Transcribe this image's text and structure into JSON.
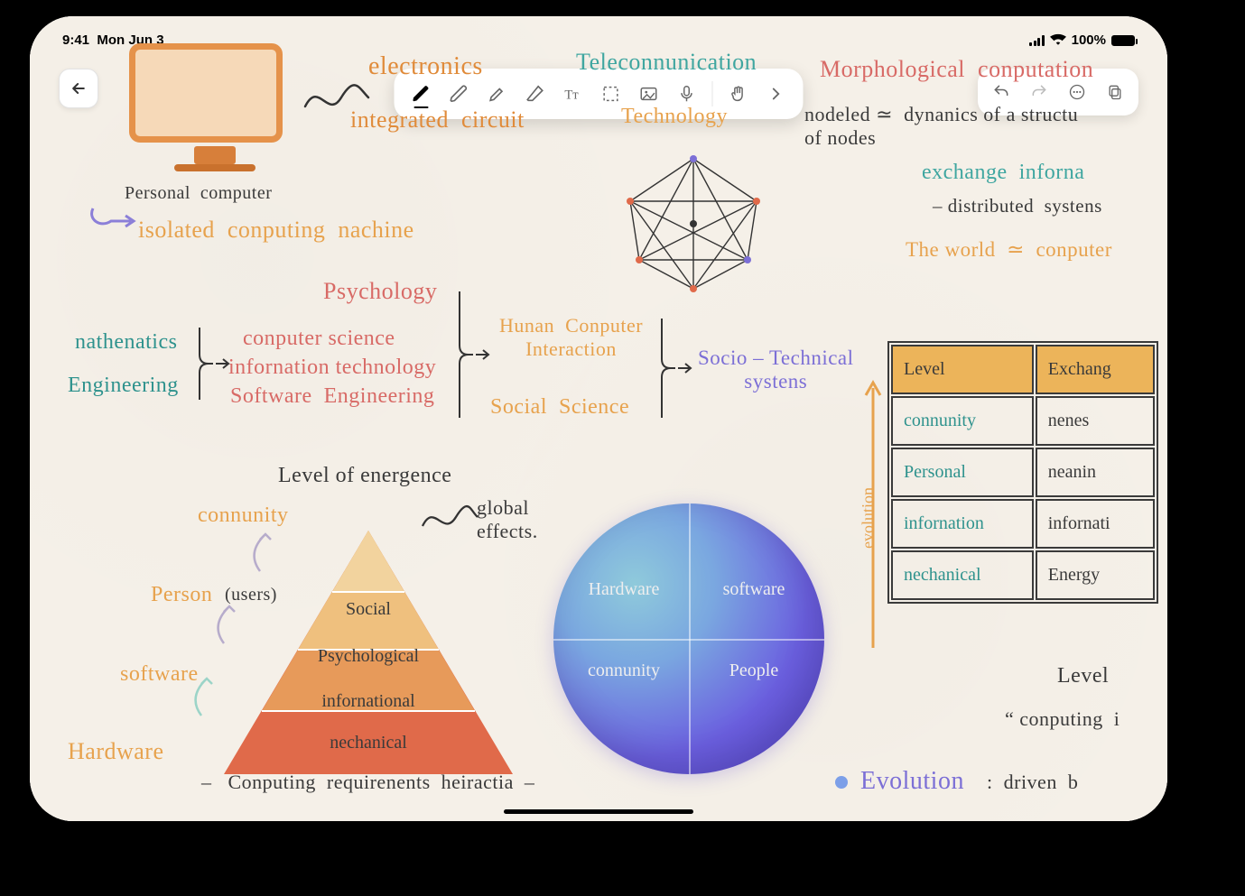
{
  "status": {
    "time": "9:41",
    "date": "Mon Jun 3",
    "battery": "100%"
  },
  "toolbar": {
    "tools": [
      "pen",
      "pencil",
      "highlighter",
      "eraser",
      "text",
      "select",
      "image",
      "mic",
      "lasso",
      "more"
    ]
  },
  "actions": [
    "undo",
    "redo",
    "more",
    "duplicate"
  ],
  "notes": {
    "personal_computer": "Personal  computer",
    "isolated": "isolated  conputing  nachine",
    "electronics": "electronics",
    "integrated": "integrated  circuit",
    "telecom": "Teleconnunication",
    "technology": "Technology",
    "morph": "Morphological  conputation",
    "nodeled": "nodeled ≃  dynanics of a structu\nof nodes",
    "exchange_info": "exchange  inforna",
    "distributed": "– distributed  systens",
    "world": "The world  ≃  conputer",
    "math": "nathenatics",
    "eng": "Engineering",
    "cs": "conputer science",
    "it": "infornation technology",
    "se": "Software  Engineering",
    "psych": "Psychology",
    "hci": "Hunan  Conputer\nInteraction",
    "social_sci": "Social  Science",
    "socio": "Socio – Technical\nsystens",
    "level_emergence": "Level of energence",
    "global": "global\neffects.",
    "pyramid": {
      "l1": "Social",
      "l2": "Psychological",
      "l3": "infornational",
      "l4": "nechanical"
    },
    "side": {
      "community": "connunity",
      "person": "Person",
      "users": "(users)",
      "software": "software",
      "hardware": "Hardware"
    },
    "globe": {
      "hw": "Hardware",
      "sw": "software",
      "community": "connunity",
      "people": "People"
    },
    "computing_req": "–   Conputing  requirenents  heiractia  –",
    "table": {
      "h1": "Level",
      "h2": "Exchang",
      "rows": [
        {
          "l": "connunity",
          "r": "nenes"
        },
        {
          "l": "Personal",
          "r": "neanin"
        },
        {
          "l": "infornation",
          "r": "infornati"
        },
        {
          "l": "nechanical",
          "r": "Energy"
        }
      ]
    },
    "evolution_axis": "evolution",
    "level_footer": "Level",
    "computing_in": "“ conputing  i",
    "evolution": "Evolution",
    "driven": ":  driven  b"
  }
}
